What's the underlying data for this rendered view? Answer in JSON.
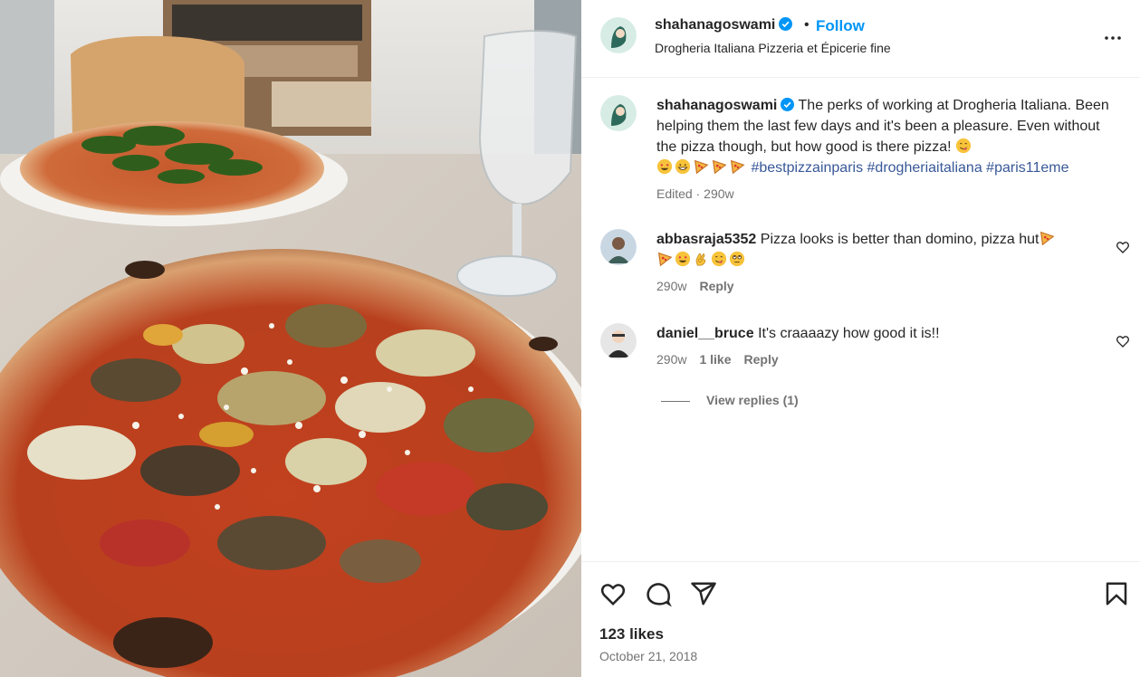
{
  "post": {
    "username": "shahanagoswami",
    "separator": "•",
    "follow_label": "Follow",
    "location": "Drogheria Italiana Pizzeria et Épicerie fine"
  },
  "caption": {
    "username": "shahanagoswami",
    "text": "The perks of working at Drogheria Italiana. Been helping them the last few days and it's been a pleasure. Even without the pizza though, but how good is there pizza!",
    "emojis": [
      "yum-emoji",
      "heart-eyes-emoji",
      "grin-emoji",
      "pizza-emoji",
      "pizza-emoji",
      "pizza-emoji"
    ],
    "hashtags": "#bestpizzainparis #drogheriaitaliana #paris11eme",
    "edited_label": "Edited",
    "time": "290w"
  },
  "comments": [
    {
      "username": "abbasraja5352",
      "text": "Pizza looks is better than domino, pizza hut",
      "emojis": [
        "pizza-emoji",
        "pizza-emoji",
        "heart-eyes-emoji",
        "ok-hand-emoji",
        "yum-emoji",
        "rolling-eyes-emoji"
      ],
      "time": "290w",
      "likes": "",
      "reply_label": "Reply"
    },
    {
      "username": "daniel__bruce",
      "text": "It's craaaazy how good it is!!",
      "emojis": [],
      "time": "290w",
      "likes": "1 like",
      "reply_label": "Reply"
    }
  ],
  "view_replies": "View replies (1)",
  "footer": {
    "likes": "123 likes",
    "date": "October 21, 2018"
  },
  "colors": {
    "accent": "#0095f6",
    "hashtag": "#385898",
    "muted": "#737373",
    "text": "#262626"
  }
}
